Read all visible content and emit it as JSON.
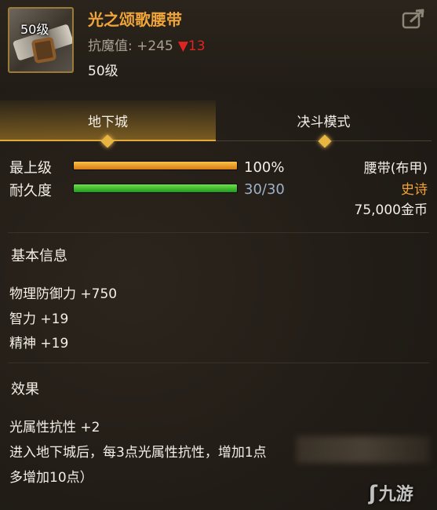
{
  "item": {
    "level_badge": "50级",
    "name": "光之颂歌腰带",
    "stat_label": "抗魔值: +245",
    "stat_change": "▼13",
    "required_level": "50级"
  },
  "tabs": [
    {
      "label": "地下城"
    },
    {
      "label": "决斗模式"
    }
  ],
  "bars": {
    "max_level": {
      "label": "最上级",
      "value": "100%",
      "fraction": 1.0
    },
    "durability": {
      "label": "耐久度",
      "value": "30/30",
      "fraction": 1.0
    }
  },
  "type_info": {
    "category": "腰带(布甲)",
    "rarity": "史诗",
    "price": "75,000金币"
  },
  "basic_info": {
    "title": "基本信息",
    "lines": [
      "物理防御力 +750",
      "智力 +19",
      "精神 +19"
    ]
  },
  "effects": {
    "title": "效果",
    "lines": [
      "光属性抗性 +2",
      "进入地下城后，每3点光属性抗性，增加1点",
      "多增加10点）"
    ]
  },
  "watermark": {
    "text": "九游"
  },
  "colors": {
    "name": "#f0a53a",
    "rarity": "#f2a334",
    "stat_down": "#e02323",
    "bar_orange": "#e89a24",
    "bar_green": "#3cc02c",
    "tab_active": "#e0a93a"
  },
  "icons": [
    "share-icon",
    "belt-icon",
    "diamond-icon"
  ]
}
